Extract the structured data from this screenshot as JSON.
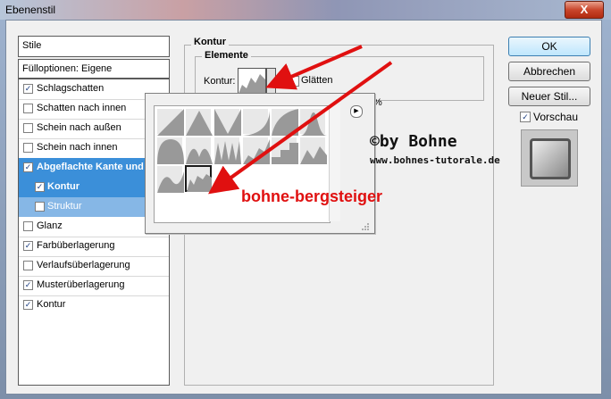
{
  "window": {
    "title": "Ebenenstil",
    "close_label": "X"
  },
  "left": {
    "styles_label": "Stile",
    "fill_options_label": "Fülloptionen: Eigene",
    "items": [
      {
        "label": "Schlagschatten",
        "checked": "✓"
      },
      {
        "label": "Schatten nach innen",
        "checked": ""
      },
      {
        "label": "Schein nach außen",
        "checked": ""
      },
      {
        "label": "Schein nach innen",
        "checked": ""
      },
      {
        "label": "Abgeflachte Kante und R",
        "checked": "✓"
      },
      {
        "label": "Kontur",
        "checked": "✓"
      },
      {
        "label": "Struktur",
        "checked": ""
      },
      {
        "label": "Glanz",
        "checked": ""
      },
      {
        "label": "Farbüberlagerung",
        "checked": "✓"
      },
      {
        "label": "Verlaufsüberlagerung",
        "checked": ""
      },
      {
        "label": "Musterüberlagerung",
        "checked": "✓"
      },
      {
        "label": "Kontur",
        "checked": "✓"
      }
    ]
  },
  "right": {
    "group_title": "Kontur",
    "subgroup_title": "Elemente",
    "contour_label": "Kontur:",
    "smooth_label": "Glätten",
    "percent_tail": "%"
  },
  "buttons": {
    "ok": "OK",
    "cancel": "Abbrechen",
    "new_style": "Neuer Stil...",
    "preview_label": "Vorschau",
    "preview_checked": "✓"
  },
  "overlay": {
    "by_text": "©by Bohne",
    "url_text": "www.bohnes-tutorale.de",
    "contour_name": "bohne-bergsteiger",
    "arrow_color": "#e01010"
  }
}
